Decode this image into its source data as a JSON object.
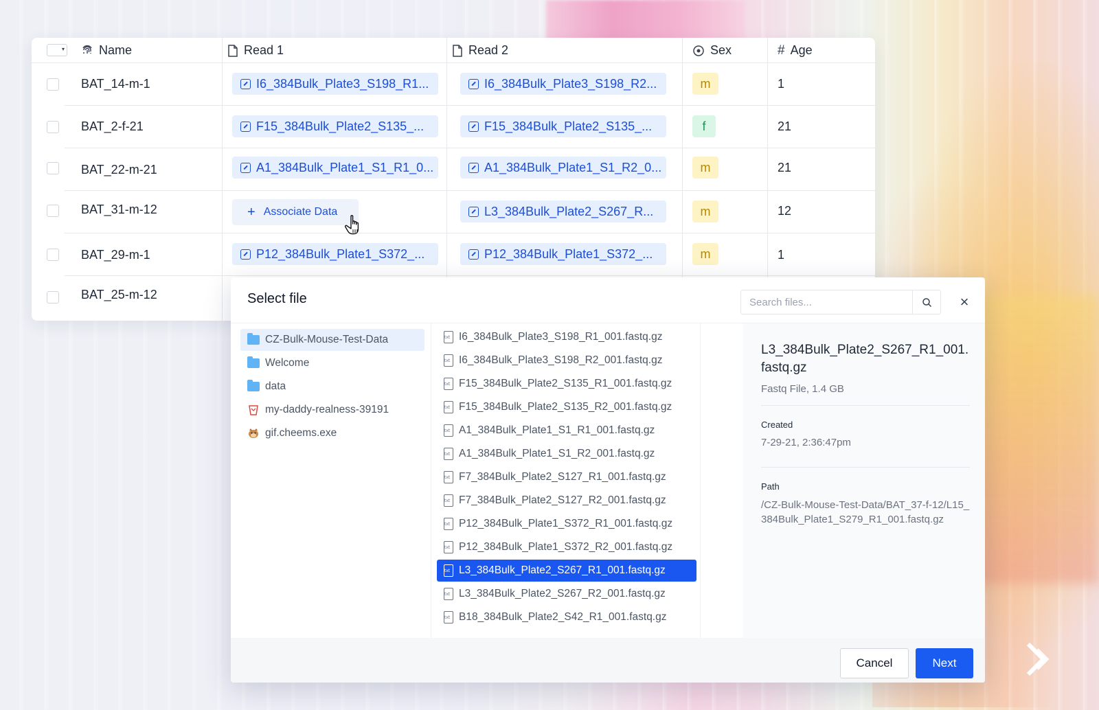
{
  "table": {
    "headers": {
      "name": "Name",
      "read1": "Read 1",
      "read2": "Read 2",
      "sex": "Sex",
      "age": "Age"
    },
    "rows": [
      {
        "name": "BAT_14-m-1",
        "read1": "I6_384Bulk_Plate3_S198_R1...",
        "read2": "I6_384Bulk_Plate3_S198_R2...",
        "sex": "m",
        "age": "1"
      },
      {
        "name": "BAT_2-f-21",
        "read1": "F15_384Bulk_Plate2_S135_...",
        "read2": "F15_384Bulk_Plate2_S135_...",
        "sex": "f",
        "age": "21"
      },
      {
        "name": "BAT_22-m-21",
        "read1": "A1_384Bulk_Plate1_S1_R1_0...",
        "read2": "A1_384Bulk_Plate1_S1_R2_0...",
        "sex": "m",
        "age": "21"
      },
      {
        "name": "BAT_31-m-12",
        "read1": "",
        "read2": "L3_384Bulk_Plate2_S267_R...",
        "sex": "m",
        "age": "12"
      },
      {
        "name": "BAT_29-m-1",
        "read1": "P12_384Bulk_Plate1_S372_...",
        "read2": "P12_384Bulk_Plate1_S372_...",
        "sex": "m",
        "age": "1"
      },
      {
        "name": "BAT_25-m-12",
        "read1": "",
        "read2": "",
        "sex": "",
        "age": ""
      }
    ],
    "associate_label": "Associate Data"
  },
  "modal": {
    "title": "Select file",
    "search_placeholder": "Search files...",
    "folders": [
      {
        "label": "CZ-Bulk-Mouse-Test-Data",
        "icon": "folder-icon"
      },
      {
        "label": "Welcome",
        "icon": "folder-icon"
      },
      {
        "label": "data",
        "icon": "folder-icon"
      },
      {
        "label": "my-daddy-realness-39191",
        "icon": "bucket-icon"
      },
      {
        "label": "gif.cheems.exe",
        "icon": "dog-icon"
      }
    ],
    "files": [
      "I6_384Bulk_Plate3_S198_R1_001.fastq.gz",
      "I6_384Bulk_Plate3_S198_R2_001.fastq.gz",
      "F15_384Bulk_Plate2_S135_R1_001.fastq.gz",
      "F15_384Bulk_Plate2_S135_R2_001.fastq.gz",
      "A1_384Bulk_Plate1_S1_R1_001.fastq.gz",
      "A1_384Bulk_Plate1_S1_R2_001.fastq.gz",
      "F7_384Bulk_Plate2_S127_R1_001.fastq.gz",
      "F7_384Bulk_Plate2_S127_R2_001.fastq.gz",
      "P12_384Bulk_Plate1_S372_R1_001.fastq.gz",
      "P12_384Bulk_Plate1_S372_R2_001.fastq.gz",
      "L3_384Bulk_Plate2_S267_R1_001.fastq.gz",
      "L3_384Bulk_Plate2_S267_R2_001.fastq.gz",
      "B18_384Bulk_Plate2_S42_R1_001.fastq.gz"
    ],
    "selected_file_index": 10,
    "detail": {
      "title": "L3_384Bulk_Plate2_S267_R1_001.fastq.gz",
      "subtitle": "Fastq File, 1.4 GB",
      "created_label": "Created",
      "created_value": "7-29-21, 2:36:47pm",
      "path_label": "Path",
      "path_value": "/CZ-Bulk-Mouse-Test-Data/BAT_37-f-12/L15_384Bulk_Plate1_S279_R1_001.fastq.gz"
    },
    "cancel_label": "Cancel",
    "next_label": "Next"
  },
  "colors": {
    "accent": "#1a5cf2",
    "chip_bg": "#e6effd",
    "sex_m_bg": "#fdf3c4",
    "sex_f_bg": "#d9f6e6"
  }
}
